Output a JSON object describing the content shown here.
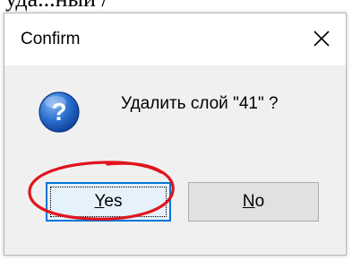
{
  "page_fragment": "уда...ный /",
  "dialog": {
    "title": "Confirm",
    "close_glyph": "✕",
    "icon": "question-icon",
    "message": "Удалить слой \"41\" ?",
    "buttons": {
      "yes": {
        "mnemonic": "Y",
        "rest": "es"
      },
      "no": {
        "mnemonic": "N",
        "rest": "o"
      }
    },
    "default_button": "yes"
  },
  "annotation": {
    "type": "hand-drawn ellipse",
    "target": "yes-button",
    "color": "#e0141e"
  },
  "colors": {
    "focus_border": "#0078d7",
    "icon_blue": "#1d64c8"
  }
}
